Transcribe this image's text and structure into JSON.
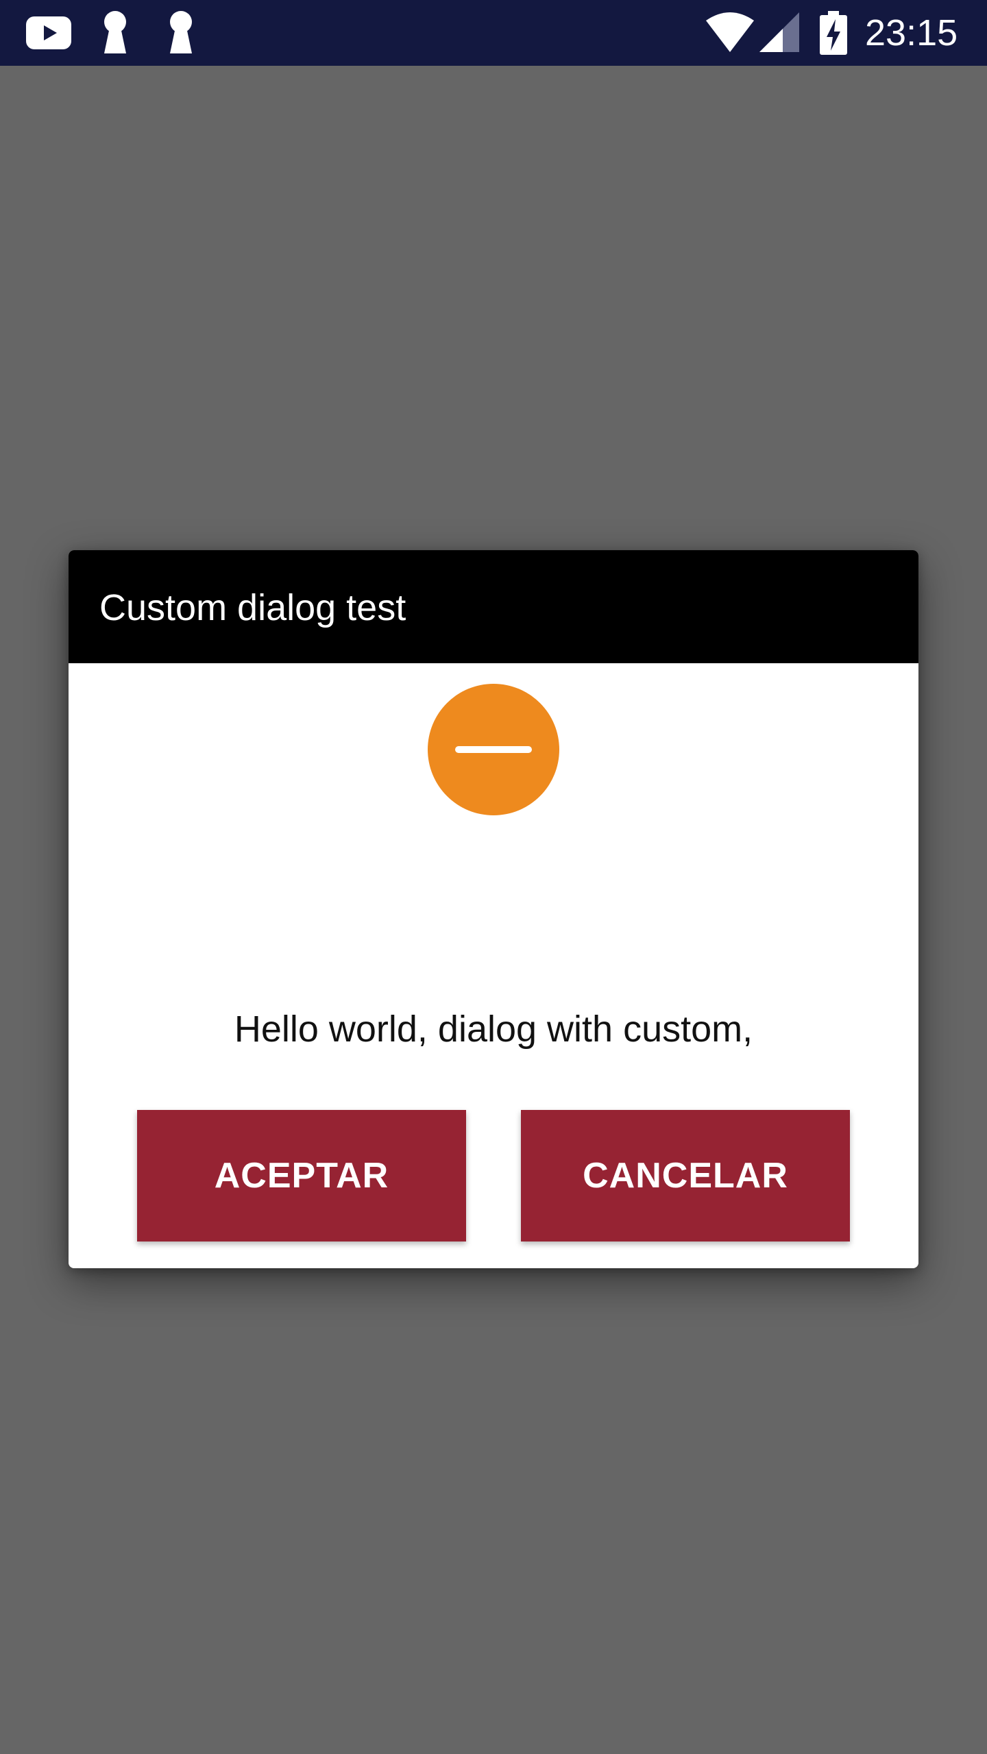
{
  "status_bar": {
    "time": "23:15",
    "icons": [
      "youtube-icon",
      "keyhole-icon",
      "keyhole-icon",
      "wifi-icon",
      "cell-signal-icon",
      "battery-charging-icon"
    ],
    "background_color": "#131840"
  },
  "dialog": {
    "title": "Custom dialog test",
    "icon": "minus-circle-icon",
    "icon_color": "#EE8A1E",
    "message": "Hello world, dialog with custom,",
    "buttons": {
      "accept_label": "ACEPTAR",
      "cancel_label": "CANCELAR"
    },
    "button_color": "#962333",
    "header_color": "#000000"
  },
  "background_color": "#666666"
}
